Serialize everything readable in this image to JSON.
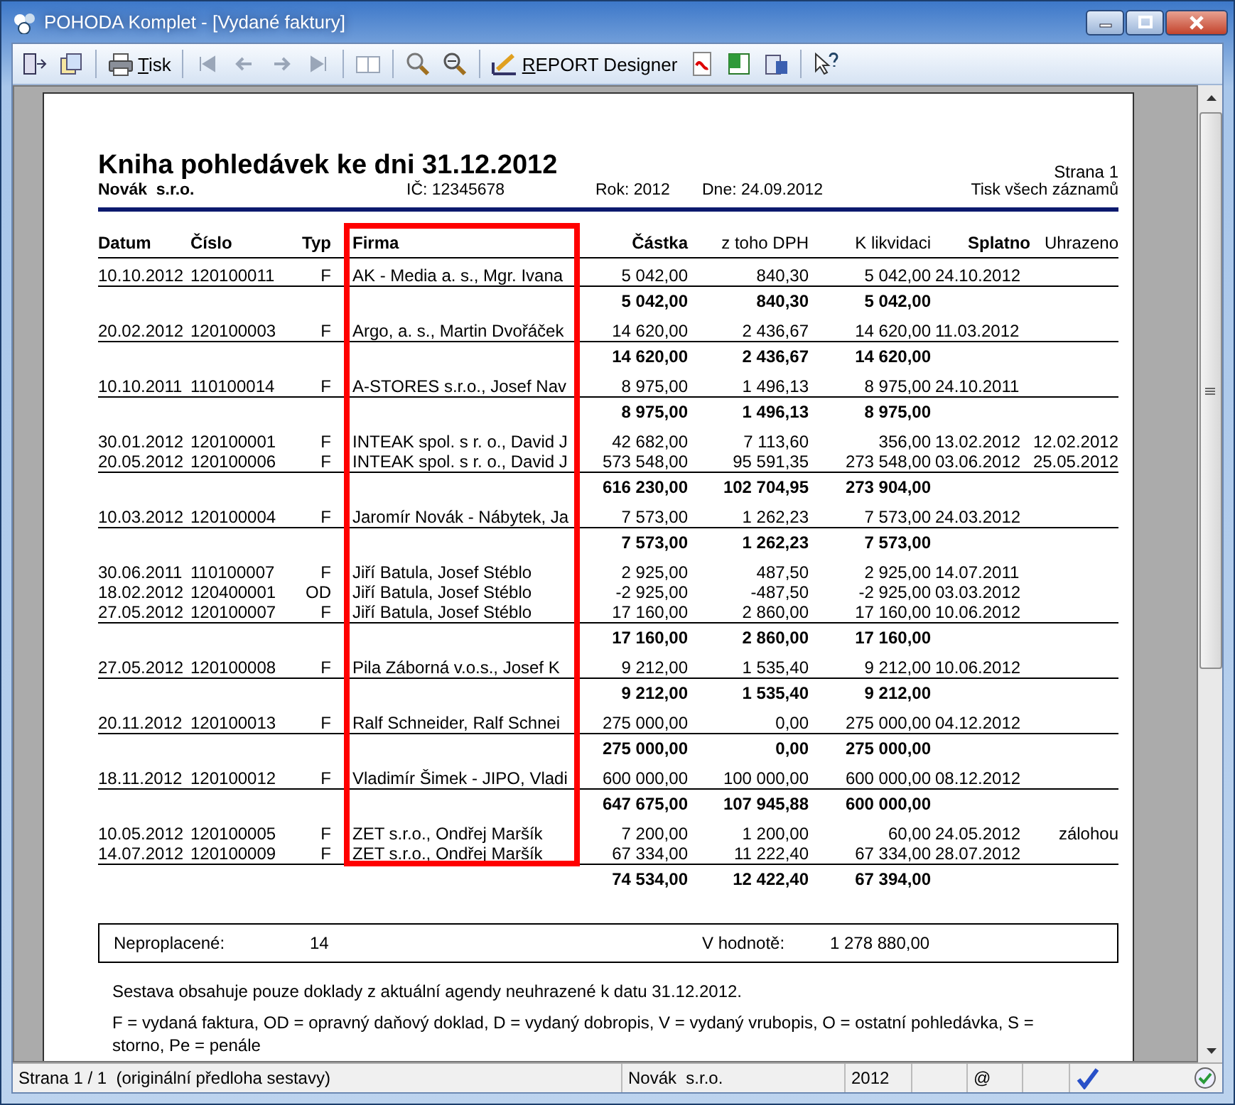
{
  "window": {
    "title": "POHODA Komplet - [Vydané faktury]"
  },
  "toolbar": {
    "print_label": "Tisk",
    "designer_label": "REPORT Designer"
  },
  "report": {
    "title": "Kniha pohledávek ke dni 31.12.2012",
    "page": "Strana 1",
    "company": "Novák  s.r.o.",
    "ic": "IČ: 12345678",
    "year": "Rok: 2012",
    "date": "Dne: 24.09.2012",
    "scope": "Tisk všech záznamů",
    "columns": [
      {
        "label": "Datum",
        "bold": true
      },
      {
        "label": "Číslo",
        "bold": true
      },
      {
        "label": "Typ",
        "bold": true
      },
      {
        "label": "Firma",
        "bold": true
      },
      {
        "label": "Částka",
        "bold": true
      },
      {
        "label": "z toho DPH",
        "bold": false
      },
      {
        "label": "K likvidaci",
        "bold": false
      },
      {
        "label": "Splatno",
        "bold": true
      },
      {
        "label": "Uhrazeno",
        "bold": false
      }
    ],
    "groups": [
      {
        "rows": [
          {
            "datum": "10.10.2012",
            "cislo": "120100011",
            "typ": "F",
            "firma": "AK - Media a. s., Mgr. Ivana",
            "castka": "5 042,00",
            "dph": "840,30",
            "likvidace": "5 042,00",
            "splatno": "24.10.2012"
          }
        ],
        "total": {
          "castka": "5 042,00",
          "dph": "840,30",
          "likvidace": "5 042,00"
        }
      },
      {
        "rows": [
          {
            "datum": "20.02.2012",
            "cislo": "120100003",
            "typ": "F",
            "firma": "Argo, a. s., Martin Dvořáček",
            "castka": "14 620,00",
            "dph": "2 436,67",
            "likvidace": "14 620,00",
            "splatno": "11.03.2012"
          }
        ],
        "total": {
          "castka": "14 620,00",
          "dph": "2 436,67",
          "likvidace": "14 620,00"
        }
      },
      {
        "rows": [
          {
            "datum": "10.10.2011",
            "cislo": "110100014",
            "typ": "F",
            "firma": "A-STORES s.r.o., Josef Nav",
            "castka": "8 975,00",
            "dph": "1 496,13",
            "likvidace": "8 975,00",
            "splatno": "24.10.2011"
          }
        ],
        "total": {
          "castka": "8 975,00",
          "dph": "1 496,13",
          "likvidace": "8 975,00"
        }
      },
      {
        "rows": [
          {
            "datum": "30.01.2012",
            "cislo": "120100001",
            "typ": "F",
            "firma": "INTEAK spol. s r. o., David J",
            "castka": "42 682,00",
            "dph": "7 113,60",
            "likvidace": "356,00",
            "splatno": "13.02.2012",
            "uhrazeno": "12.02.2012"
          },
          {
            "datum": "20.05.2012",
            "cislo": "120100006",
            "typ": "F",
            "firma": "INTEAK spol. s r. o., David J",
            "castka": "573 548,00",
            "dph": "95 591,35",
            "likvidace": "273 548,00",
            "splatno": "03.06.2012",
            "uhrazeno": "25.05.2012"
          }
        ],
        "total": {
          "castka": "616 230,00",
          "dph": "102 704,95",
          "likvidace": "273 904,00"
        }
      },
      {
        "rows": [
          {
            "datum": "10.03.2012",
            "cislo": "120100004",
            "typ": "F",
            "firma": "Jaromír Novák - Nábytek, Ja",
            "castka": "7 573,00",
            "dph": "1 262,23",
            "likvidace": "7 573,00",
            "splatno": "24.03.2012"
          }
        ],
        "total": {
          "castka": "7 573,00",
          "dph": "1 262,23",
          "likvidace": "7 573,00"
        }
      },
      {
        "rows": [
          {
            "datum": "30.06.2011",
            "cislo": "110100007",
            "typ": "F",
            "firma": "Jiří Batula, Josef Stéblo",
            "castka": "2 925,00",
            "dph": "487,50",
            "likvidace": "2 925,00",
            "splatno": "14.07.2011"
          },
          {
            "datum": "18.02.2012",
            "cislo": "120400001",
            "typ": "OD",
            "firma": "Jiří Batula, Josef Stéblo",
            "castka": "-2 925,00",
            "dph": "-487,50",
            "likvidace": "-2 925,00",
            "splatno": "03.03.2012"
          },
          {
            "datum": "27.05.2012",
            "cislo": "120100007",
            "typ": "F",
            "firma": "Jiří Batula, Josef Stéblo",
            "castka": "17 160,00",
            "dph": "2 860,00",
            "likvidace": "17 160,00",
            "splatno": "10.06.2012"
          }
        ],
        "total": {
          "castka": "17 160,00",
          "dph": "2 860,00",
          "likvidace": "17 160,00"
        }
      },
      {
        "rows": [
          {
            "datum": "27.05.2012",
            "cislo": "120100008",
            "typ": "F",
            "firma": "Pila Záborná v.o.s., Josef K",
            "castka": "9 212,00",
            "dph": "1 535,40",
            "likvidace": "9 212,00",
            "splatno": "10.06.2012"
          }
        ],
        "total": {
          "castka": "9 212,00",
          "dph": "1 535,40",
          "likvidace": "9 212,00"
        }
      },
      {
        "rows": [
          {
            "datum": "20.11.2012",
            "cislo": "120100013",
            "typ": "F",
            "firma": "Ralf Schneider, Ralf Schnei",
            "castka": "275 000,00",
            "dph": "0,00",
            "likvidace": "275 000,00",
            "splatno": "04.12.2012"
          }
        ],
        "total": {
          "castka": "275 000,00",
          "dph": "0,00",
          "likvidace": "275 000,00"
        }
      },
      {
        "rows": [
          {
            "datum": "18.11.2012",
            "cislo": "120100012",
            "typ": "F",
            "firma": "Vladimír Šimek - JIPO, Vladi",
            "castka": "600 000,00",
            "dph": "100 000,00",
            "likvidace": "600 000,00",
            "splatno": "08.12.2012"
          }
        ],
        "total": {
          "castka": "647 675,00",
          "dph": "107 945,88",
          "likvidace": "600 000,00"
        }
      },
      {
        "rows": [
          {
            "datum": "10.05.2012",
            "cislo": "120100005",
            "typ": "F",
            "firma": "ZET s.r.o., Ondřej Maršík",
            "castka": "7 200,00",
            "dph": "1 200,00",
            "likvidace": "60,00",
            "splatno": "24.05.2012",
            "uhrazeno": "zálohou"
          },
          {
            "datum": "14.07.2012",
            "cislo": "120100009",
            "typ": "F",
            "firma": "ZET s.r.o., Ondřej Maršík",
            "castka": "67 334,00",
            "dph": "11 222,40",
            "likvidace": "67 334,00",
            "splatno": "28.07.2012"
          }
        ],
        "total": {
          "castka": "74 534,00",
          "dph": "12 422,40",
          "likvidace": "67 394,00"
        }
      }
    ],
    "summary": {
      "unpaid_label": "Neproplacené:",
      "unpaid_count": "14",
      "value_label": "V hodnotě:",
      "value": "1 278 880,00"
    },
    "notes": [
      "Sestava obsahuje pouze doklady z aktuální agendy neuhrazené k datu 31.12.2012.",
      "F = vydaná faktura, OD = opravný daňový doklad, D = vydaný dobropis, V = vydaný vrubopis, O = ostatní pohledávka, S = storno, Pe = penále"
    ]
  },
  "status_bar": {
    "page": "Strana 1 / 1  (originální předloha sestavy)",
    "company": "Novák  s.r.o.",
    "year": "2012",
    "email": "@"
  }
}
